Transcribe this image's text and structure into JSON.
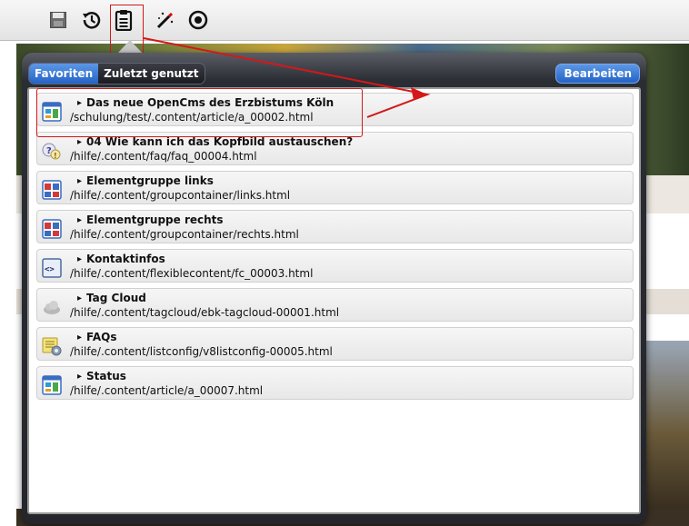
{
  "popup": {
    "tabs": [
      {
        "label": "Favoriten"
      },
      {
        "label": "Zuletzt genutzt"
      }
    ],
    "edit_label": "Bearbeiten",
    "items": [
      {
        "title": "Das neue OpenCms des Erzbistums Köln",
        "path": "/schulung/test/.content/article/a_00002.html",
        "icon": "article-icon"
      },
      {
        "title": "04 Wie kann ich das Kopfbild austauschen?",
        "path": "/hilfe/.content/faq/faq_00004.html",
        "icon": "faq-icon"
      },
      {
        "title": "Elementgruppe links",
        "path": "/hilfe/.content/groupcontainer/links.html",
        "icon": "groupcontainer-icon"
      },
      {
        "title": "Elementgruppe rechts",
        "path": "/hilfe/.content/groupcontainer/rechts.html",
        "icon": "groupcontainer-icon"
      },
      {
        "title": "Kontaktinfos",
        "path": "/hilfe/.content/flexiblecontent/fc_00003.html",
        "icon": "flexiblecontent-icon"
      },
      {
        "title": "Tag Cloud",
        "path": "/hilfe/.content/tagcloud/ebk-tagcloud-00001.html",
        "icon": "tagcloud-icon"
      },
      {
        "title": "FAQs",
        "path": "/hilfe/.content/listconfig/v8listconfig-00005.html",
        "icon": "listconfig-icon"
      },
      {
        "title": "Status",
        "path": "/hilfe/.content/article/a_00007.html",
        "icon": "article-icon"
      }
    ]
  },
  "toolbar": {
    "buttons": [
      "save-icon",
      "history-icon",
      "clipboard-icon",
      "magic-wand-icon",
      "target-icon"
    ]
  },
  "colors": {
    "accent_blue": "#2f6fd6",
    "highlight_red": "#d4181a"
  }
}
